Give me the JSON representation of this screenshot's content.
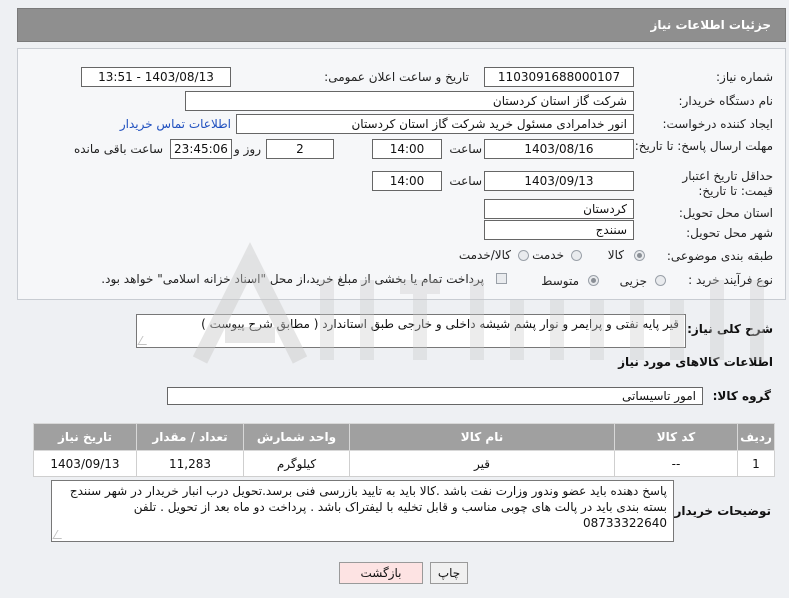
{
  "header": {
    "title": "جزئیات اطلاعات نیاز"
  },
  "form": {
    "need_number_label": "شماره نیاز:",
    "need_number": "1103091688000107",
    "announce_label": "تاریخ و ساعت اعلان عمومی:",
    "announce_value": "1403/08/13 - 13:51",
    "buyer_org_label": "نام دستگاه خریدار:",
    "buyer_org": "شرکت گاز استان کردستان",
    "requester_label": "ایجاد کننده درخواست:",
    "requester": "انور خدامرادی مسئول خرید  شرکت گاز استان کردستان",
    "contact_link": "اطلاعات تماس خریدار",
    "deadline_label": "مهلت ارسال پاسخ: تا تاریخ:",
    "deadline_date": "1403/08/16",
    "time_label": "ساعت",
    "deadline_time": "14:00",
    "days_value": "2",
    "days_label": "روز و",
    "remaining_time": "23:45:06",
    "remaining_label": "ساعت باقی مانده",
    "validity_label": "حداقل تاریخ اعتبار قیمت: تا تاریخ:",
    "validity_date": "1403/09/13",
    "validity_time": "14:00",
    "province_label": "استان محل تحویل:",
    "province": "کردستان",
    "city_label": "شهر محل تحویل:",
    "city": "سنندج",
    "category_label": "طبقه بندی موضوعی:",
    "category_options": [
      "کالا",
      "خدمت",
      "کالا/خدمت"
    ],
    "process_label": "نوع فرآیند خرید :",
    "process_options": [
      "جزیی",
      "متوسط"
    ],
    "payment_note": "پرداخت تمام یا بخشی از مبلغ خرید،از محل \"اسناد خزانه اسلامی\" خواهد بود."
  },
  "description": {
    "label": "شرح کلی نیاز:",
    "text": "قیر پایه نفتی و پرایمر  و نوار پشم شیشه داخلی و خارجی طبق استاندارد ( مطابق شرح پیوست )"
  },
  "goods": {
    "section_title": "اطلاعات کالاهای مورد نیاز",
    "group_label": "گروه کالا:",
    "group_value": "امور تاسیساتی",
    "columns": [
      "ردیف",
      "کد کالا",
      "نام کالا",
      "واحد شمارش",
      "تعداد / مقدار",
      "تاریخ نیاز"
    ],
    "rows": [
      {
        "row": "1",
        "code": "--",
        "name": "قیر",
        "unit": "کیلوگرم",
        "qty": "11,283",
        "date": "1403/09/13"
      }
    ]
  },
  "buyer_notes": {
    "label": "توضیحات خریدار:",
    "text": "پاسخ دهنده باید عضو وندور وزارت نفت باشد .کالا باید به تایید بازرسی فنی  برسد.تحویل درب انبار خریدار در شهر سنندج بسته بندی باید در پالت های چوبی مناسب و قابل تخلیه با لیفتراک باشد . پرداخت دو ماه بعد از تحویل . تلفن 08733322640"
  },
  "buttons": {
    "print": "چاپ",
    "back": "بازگشت"
  }
}
